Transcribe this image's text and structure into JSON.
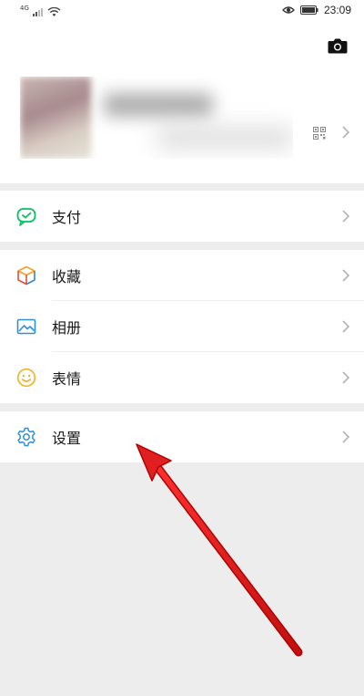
{
  "status_bar": {
    "network": "4G",
    "time": "23:09"
  },
  "menu": {
    "pay": "支付",
    "favorites": "收藏",
    "album": "相册",
    "stickers": "表情",
    "settings": "设置"
  },
  "colors": {
    "accent_green": "#07c160",
    "arrow_red": "#e02020",
    "chevron": "#b2b2b2"
  }
}
